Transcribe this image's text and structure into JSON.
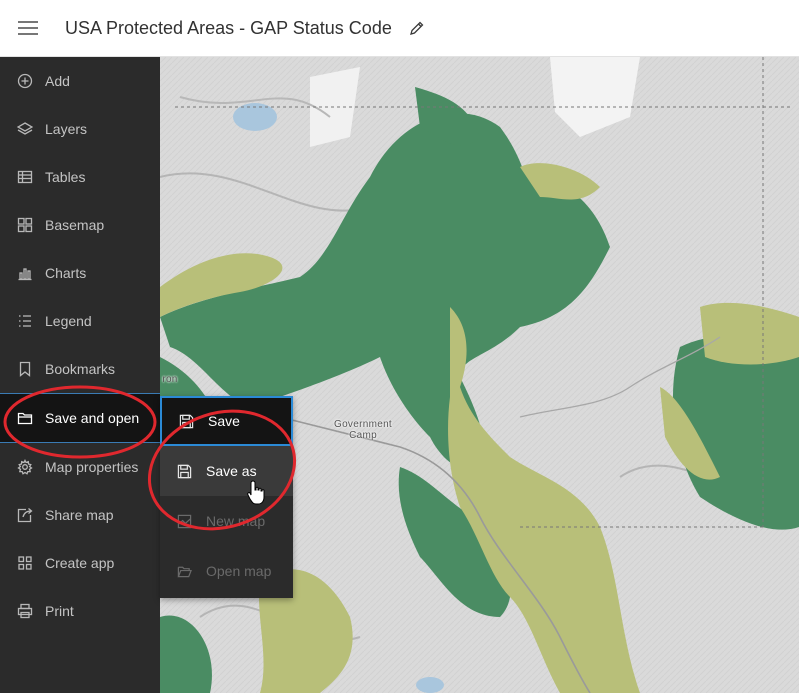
{
  "header": {
    "menu_icon": "hamburger-icon",
    "title": "USA Protected Areas - GAP Status Code",
    "edit_icon": "pencil-icon"
  },
  "sidebar": {
    "items": [
      {
        "label": "Add",
        "icon": "plus-circle-icon"
      },
      {
        "label": "Layers",
        "icon": "layers-icon"
      },
      {
        "label": "Tables",
        "icon": "table-icon"
      },
      {
        "label": "Basemap",
        "icon": "basemap-icon"
      },
      {
        "label": "Charts",
        "icon": "chart-icon"
      },
      {
        "label": "Legend",
        "icon": "legend-icon"
      },
      {
        "label": "Bookmarks",
        "icon": "bookmark-icon"
      },
      {
        "label": "Save and open",
        "icon": "folder-icon",
        "active": true
      },
      {
        "label": "Map properties",
        "icon": "gear-icon"
      },
      {
        "label": "Share map",
        "icon": "share-icon"
      },
      {
        "label": "Create app",
        "icon": "apps-icon"
      },
      {
        "label": "Print",
        "icon": "printer-icon"
      }
    ]
  },
  "flyout": {
    "items": [
      {
        "label": "Save",
        "icon": "save-icon",
        "state": "selected"
      },
      {
        "label": "Save as",
        "icon": "save-icon",
        "state": "hover"
      },
      {
        "label": "New map",
        "icon": "new-map-icon",
        "state": "disabled"
      },
      {
        "label": "Open map",
        "icon": "folder-open-icon",
        "state": "disabled"
      }
    ]
  },
  "map": {
    "labels": [
      {
        "text": "Government Camp"
      },
      {
        "text": "ron"
      }
    ]
  },
  "colors": {
    "sidebar_bg": "#2b2b2b",
    "active_bg": "#141414",
    "focus_blue": "#2b8ad6",
    "annotation_red": "#e0282e",
    "protected_green": "#4a8c63",
    "protected_khaki": "#b8bf79"
  }
}
